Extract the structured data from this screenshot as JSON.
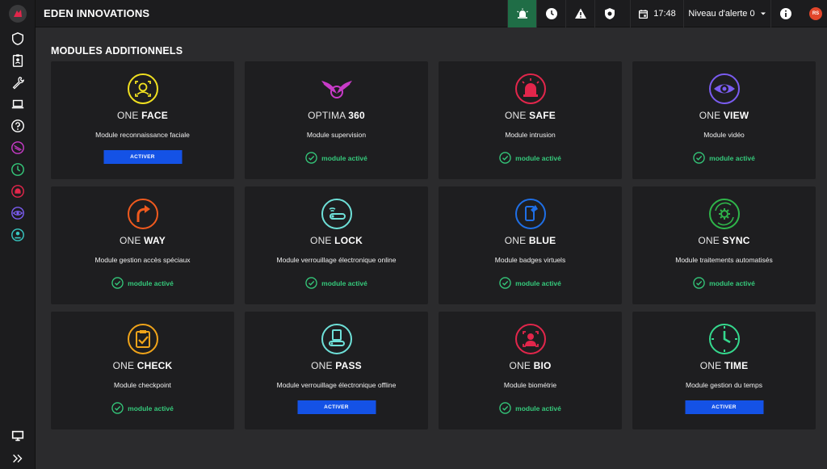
{
  "app": {
    "title": "EDEN INNOVATIONS"
  },
  "topbar": {
    "time": "17:48",
    "alert_level": "Niveau d'alerte 0",
    "avatar_initials": "RS",
    "alarm_color": "#1f6d46"
  },
  "sidebar": {
    "items": [
      {
        "icon": "shield-icon",
        "color": "#ffffff"
      },
      {
        "icon": "badge-icon",
        "color": "#ffffff"
      },
      {
        "icon": "wrench-icon",
        "color": "#ffffff"
      },
      {
        "icon": "laptop-icon",
        "color": "#ffffff"
      },
      {
        "icon": "help-icon",
        "color": "#ffffff"
      },
      {
        "icon": "optima-icon",
        "color": "#c83bc8"
      },
      {
        "icon": "clock-icon",
        "color": "#35c97b"
      },
      {
        "icon": "alarm-icon",
        "color": "#e2264b"
      },
      {
        "icon": "eye-icon",
        "color": "#7a5cf0"
      },
      {
        "icon": "user-circle-icon",
        "color": "#38c7c2"
      }
    ],
    "bottom_items": [
      {
        "icon": "monitor-icon"
      },
      {
        "icon": "expand-icon"
      }
    ]
  },
  "main": {
    "title": "MODULES ADDITIONNELS",
    "activate_label": "ACTIVER",
    "active_label": "module activé",
    "modules": [
      {
        "prefix": "ONE ",
        "name": "FACE",
        "desc": "Module reconnaissance faciale",
        "active": false,
        "color": "#f0e020",
        "icon": "face-scan-icon"
      },
      {
        "prefix": "OPTIMA ",
        "name": "360",
        "desc": "Module supervision",
        "active": true,
        "color": "#c83bc8",
        "icon": "wings-icon"
      },
      {
        "prefix": "ONE ",
        "name": "SAFE",
        "desc": "Module intrusion",
        "active": true,
        "color": "#e2264b",
        "icon": "siren-icon"
      },
      {
        "prefix": "ONE ",
        "name": "VIEW",
        "desc": "Module vidéo",
        "active": true,
        "color": "#7a5cf0",
        "icon": "eye-icon"
      },
      {
        "prefix": "ONE ",
        "name": "WAY",
        "desc": "Module gestion accès spéciaux",
        "active": true,
        "color": "#f05a1e",
        "icon": "turn-arrow-icon"
      },
      {
        "prefix": "ONE ",
        "name": "LOCK",
        "desc": "Module verrouillage électronique online",
        "active": true,
        "color": "#6ee0d8",
        "icon": "wireless-lock-icon"
      },
      {
        "prefix": "ONE ",
        "name": "BLUE",
        "desc": "Module badges virtuels",
        "active": true,
        "color": "#1f6fe6",
        "icon": "phone-badge-icon"
      },
      {
        "prefix": "ONE ",
        "name": "SYNC",
        "desc": "Module traitements automatisés",
        "active": true,
        "color": "#2fb54a",
        "icon": "sync-gear-icon"
      },
      {
        "prefix": "ONE ",
        "name": "CHECK",
        "desc": "Module checkpoint",
        "active": true,
        "color": "#f0a41a",
        "icon": "clipboard-check-icon"
      },
      {
        "prefix": "ONE ",
        "name": "PASS",
        "desc": "Module verrouillage électronique offline",
        "active": false,
        "color": "#6ee0d8",
        "icon": "door-handle-icon"
      },
      {
        "prefix": "ONE ",
        "name": "BIO",
        "desc": "Module biométrie",
        "active": true,
        "color": "#e2264b",
        "icon": "biometric-icon"
      },
      {
        "prefix": "ONE ",
        "name": "TIME",
        "desc": "Module gestion du temps",
        "active": false,
        "color": "#35d98e",
        "icon": "clock-icon"
      }
    ]
  }
}
